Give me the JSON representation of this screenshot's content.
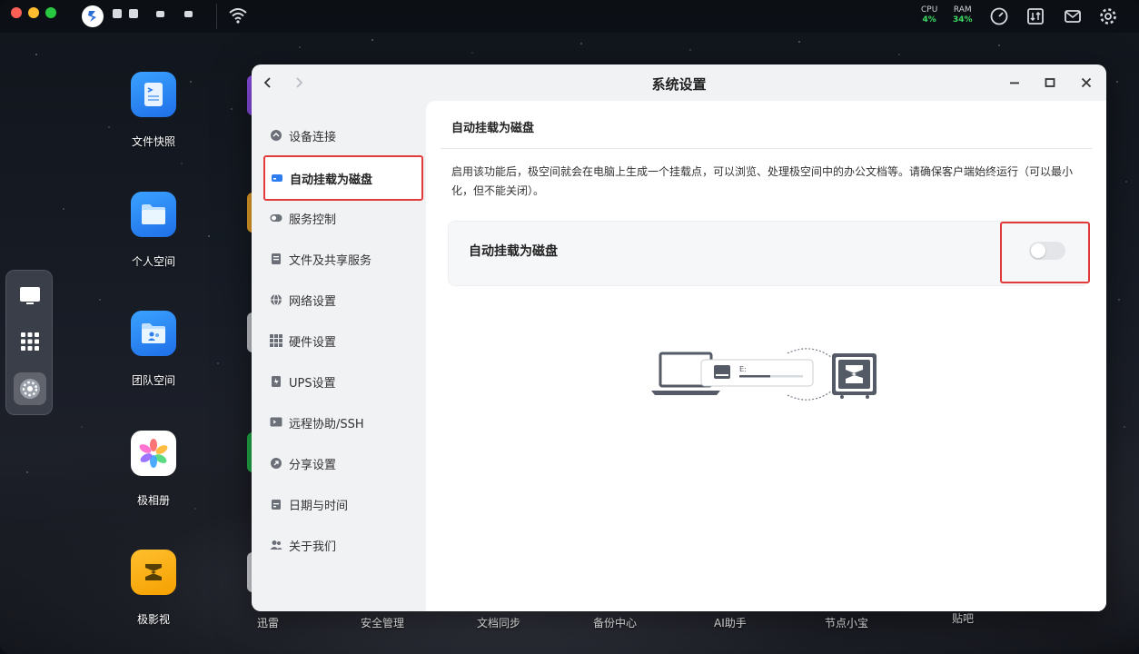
{
  "topbar": {
    "cpu_label": "CPU",
    "cpu_value": "4%",
    "ram_label": "RAM",
    "ram_value": "34%"
  },
  "desktop_icons": [
    {
      "label": "文件快照",
      "icon": "file-snapshot-icon"
    },
    {
      "label": "个人空间",
      "icon": "folder-icon"
    },
    {
      "label": "团队空间",
      "icon": "team-folder-icon"
    },
    {
      "label": "极相册",
      "icon": "photos-icon"
    },
    {
      "label": "极影视",
      "icon": "video-icon"
    }
  ],
  "bottom_labels": [
    "迅雷",
    "安全管理",
    "文档同步",
    "备份中心",
    "AI助手",
    "节点小宝",
    "贴吧"
  ],
  "window": {
    "title": "系统设置",
    "sidebar": [
      {
        "label": "设备连接",
        "icon": "device-link-icon"
      },
      {
        "label": "自动挂载为磁盘",
        "icon": "disk-icon",
        "active": true
      },
      {
        "label": "服务控制",
        "icon": "toggle-icon"
      },
      {
        "label": "文件及共享服务",
        "icon": "file-share-icon"
      },
      {
        "label": "网络设置",
        "icon": "globe-icon"
      },
      {
        "label": "硬件设置",
        "icon": "grid-icon"
      },
      {
        "label": "UPS设置",
        "icon": "ups-icon"
      },
      {
        "label": "远程协助/SSH",
        "icon": "remote-icon"
      },
      {
        "label": "分享设置",
        "icon": "share-icon"
      },
      {
        "label": "日期与时间",
        "icon": "calendar-icon"
      },
      {
        "label": "关于我们",
        "icon": "people-icon"
      }
    ],
    "content": {
      "title": "自动挂载为磁盘",
      "description": "启用该功能后，极空间就会在电脑上生成一个挂载点，可以浏览、处理极空间中的办公文档等。请确保客户端始终运行（可以最小化，但不能关闭）。",
      "toggle_label": "自动挂载为磁盘",
      "toggle_on": false,
      "drive_letter": "E:"
    }
  },
  "colors": {
    "highlight": "#e03a3a",
    "cpu_value": "#3ddc62"
  }
}
